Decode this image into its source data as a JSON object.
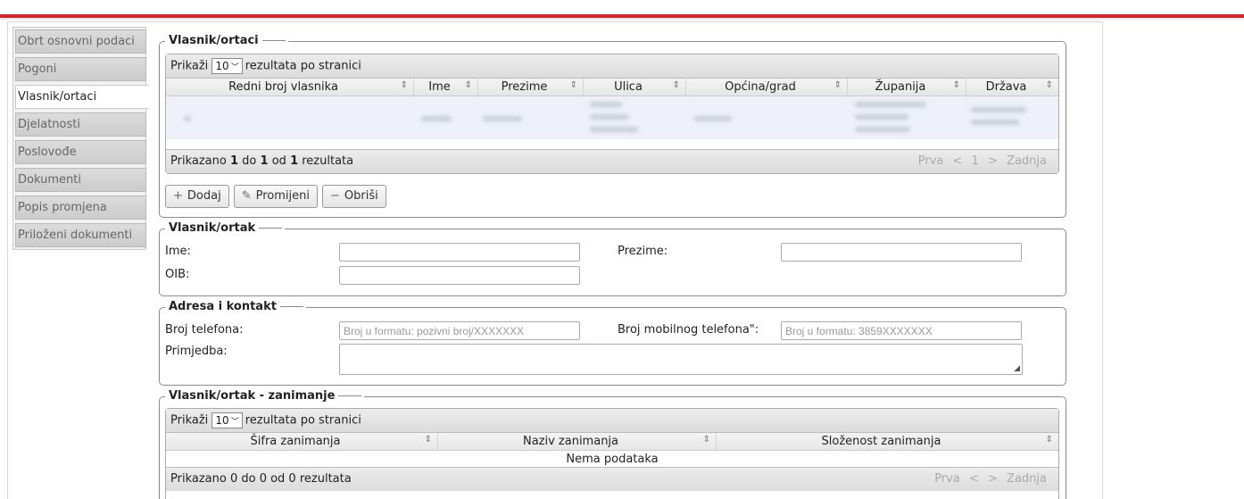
{
  "tabs": [
    {
      "label": "Obrt osnovni podaci",
      "active": false
    },
    {
      "label": "Pogoni",
      "active": false
    },
    {
      "label": "Vlasnik/ortaci",
      "active": true
    },
    {
      "label": "Djelatnosti",
      "active": false
    },
    {
      "label": "Poslovođe",
      "active": false
    },
    {
      "label": "Dokumenti",
      "active": false
    },
    {
      "label": "Popis promjena",
      "active": false
    },
    {
      "label": "Priloženi dokumenti",
      "active": false
    }
  ],
  "owners": {
    "legend": "Vlasnik/ortaci",
    "show_prefix": "Prikaži",
    "page_size": "10",
    "show_suffix": "rezultata po stranici",
    "columns": [
      "Redni broj vlasnika",
      "Ime",
      "Prezime",
      "Ulica",
      "Općina/grad",
      "Županija",
      "Država"
    ],
    "footer": {
      "prefix": "Prikazano",
      "from": "1",
      "mid1": "do",
      "to": "1",
      "mid2": "od",
      "total": "1",
      "suffix": "rezultata"
    },
    "pager": {
      "first": "Prva",
      "prev": "<",
      "page": "1",
      "next": ">",
      "last": "Zadnja"
    },
    "buttons": {
      "add": "Dodaj",
      "edit": "Promijeni",
      "delete": "Obriši"
    }
  },
  "owner": {
    "legend": "Vlasnik/ortak",
    "first_name_label": "Ime:",
    "first_name_value": "",
    "last_name_label": "Prezime:",
    "last_name_value": "",
    "oib_label": "OIB:",
    "oib_value": ""
  },
  "contact": {
    "legend": "Adresa i kontakt",
    "phone_label": "Broj telefona:",
    "phone_placeholder": "Broj u formatu: pozivni broj/XXXXXXX",
    "mobile_label": "Broj mobilnog telefona\":",
    "mobile_placeholder": "Broj u formatu: 3859XXXXXXX",
    "note_label": "Primjedba:"
  },
  "occupation": {
    "legend": "Vlasnik/ortak - zanimanje",
    "show_prefix": "Prikaži",
    "page_size": "10",
    "show_suffix": "rezultata po stranici",
    "columns": [
      "Šifra zanimanja",
      "Naziv zanimanja",
      "Složenost zanimanja"
    ],
    "empty": "Nema podataka",
    "footer": "Prikazano 0 do 0 od 0 rezultata",
    "pager": {
      "first": "Prva",
      "prev": "<",
      "next": ">",
      "last": "Zadnja"
    }
  },
  "icons": {
    "add": "plus-icon",
    "edit": "pencil-icon",
    "delete": "minus-icon",
    "sort": "sort-icon",
    "dropdown": "chevron-down-icon"
  },
  "colors": {
    "accent_bar": "#d9232b"
  }
}
